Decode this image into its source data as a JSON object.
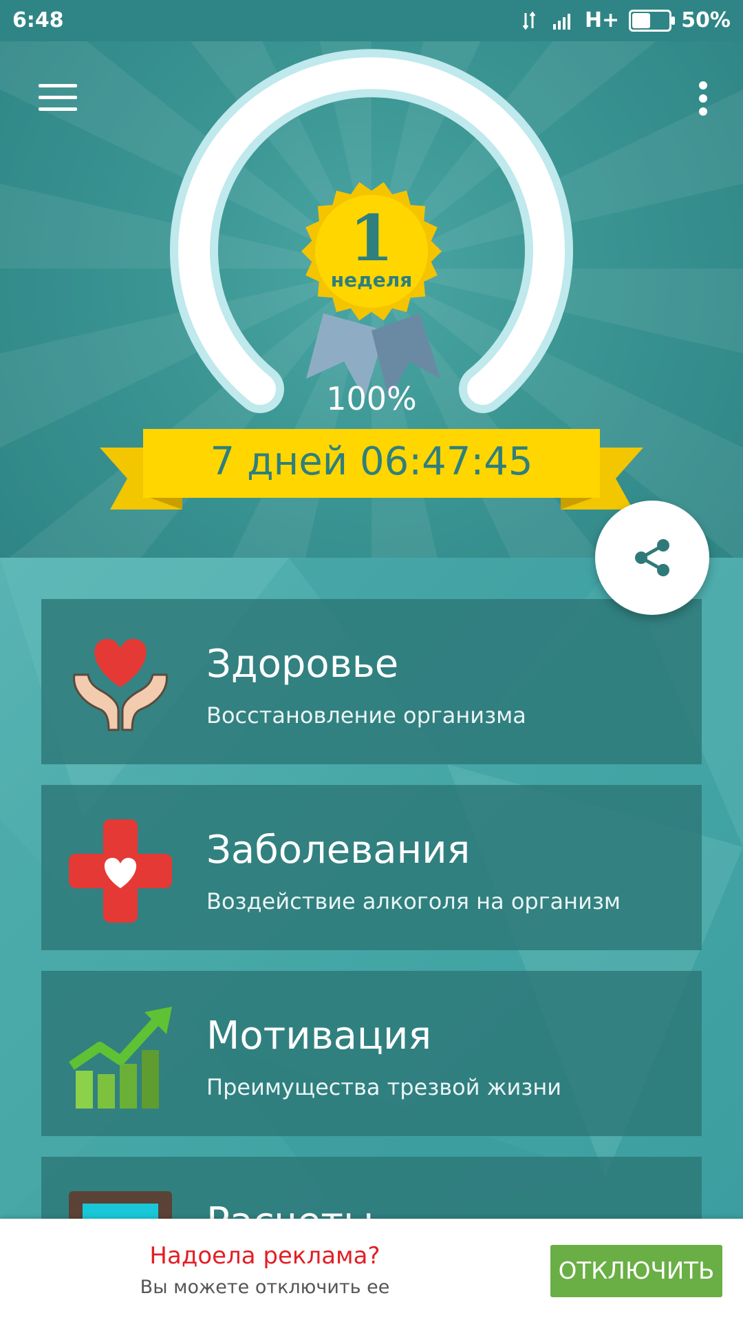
{
  "status_bar": {
    "time": "6:48",
    "network": "H+",
    "battery": "50%",
    "battery_level": 0.5
  },
  "hero": {
    "badge_number": "1",
    "badge_label": "неделя",
    "percent": "100%",
    "progress": 1.0,
    "timer": "7 дней 06:47:45"
  },
  "cards": [
    {
      "title": "Здоровье",
      "subtitle": "Восстановление организма",
      "icon": "hands-heart-icon"
    },
    {
      "title": "Заболевания",
      "subtitle": "Воздействие алкоголя на организм",
      "icon": "medical-cross-heart-icon"
    },
    {
      "title": "Мотивация",
      "subtitle": "Преимущества трезвой жизни",
      "icon": "growth-chart-icon"
    },
    {
      "title": "Расчеты",
      "subtitle": "",
      "icon": "calculator-icon"
    }
  ],
  "ad_bar": {
    "title": "Надоела реклама?",
    "subtitle": "Вы можете отключить ее",
    "button": "ОТКЛЮЧИТЬ"
  },
  "colors": {
    "teal_dark": "#2f8585",
    "ribbon_yellow": "#ffd600",
    "ad_red": "#e31e24",
    "ad_green": "#6aaf45"
  }
}
